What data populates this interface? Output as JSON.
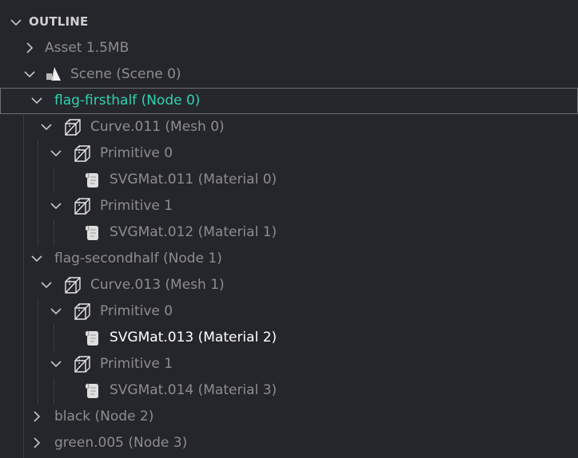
{
  "panel": {
    "section_title": "OUTLINE",
    "colors": {
      "background": "#25262b",
      "text_dim": "#8d8d8d",
      "text_highlight": "#2fd3b0",
      "text_active": "#ffffff",
      "selection_border": "#6e6f74"
    }
  },
  "tree": [
    {
      "label": "Asset 1.5MB",
      "twisty": "collapsed",
      "icon": "none"
    },
    {
      "label": "Scene (Scene 0)",
      "twisty": "expanded",
      "icon": "scene-icon"
    },
    {
      "label": "flag-firsthalf (Node 0)",
      "twisty": "expanded",
      "icon": "none",
      "state": "selected"
    },
    {
      "label": "Curve.011 (Mesh 0)",
      "twisty": "expanded",
      "icon": "mesh-icon"
    },
    {
      "label": "Primitive 0",
      "twisty": "expanded",
      "icon": "mesh-icon"
    },
    {
      "label": "SVGMat.011 (Material 0)",
      "twisty": "none",
      "icon": "material-icon"
    },
    {
      "label": "Primitive 1",
      "twisty": "expanded",
      "icon": "mesh-icon"
    },
    {
      "label": "SVGMat.012 (Material 1)",
      "twisty": "none",
      "icon": "material-icon"
    },
    {
      "label": "flag-secondhalf (Node 1)",
      "twisty": "expanded",
      "icon": "none"
    },
    {
      "label": "Curve.013 (Mesh 1)",
      "twisty": "expanded",
      "icon": "mesh-icon"
    },
    {
      "label": "Primitive 0",
      "twisty": "expanded",
      "icon": "mesh-icon"
    },
    {
      "label": "SVGMat.013 (Material 2)",
      "twisty": "none",
      "icon": "material-icon",
      "state": "active"
    },
    {
      "label": "Primitive 1",
      "twisty": "expanded",
      "icon": "mesh-icon"
    },
    {
      "label": "SVGMat.014 (Material 3)",
      "twisty": "none",
      "icon": "material-icon"
    },
    {
      "label": "black (Node 2)",
      "twisty": "collapsed",
      "icon": "none"
    },
    {
      "label": "green.005 (Node 3)",
      "twisty": "collapsed",
      "icon": "none"
    }
  ]
}
